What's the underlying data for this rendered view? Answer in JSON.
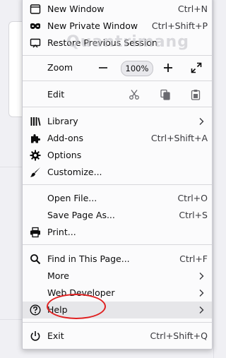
{
  "background": {
    "accent": "#0a84ff"
  },
  "watermark": {
    "text": "Quantrimang"
  },
  "menu": {
    "items": {
      "new_window": {
        "label": "New Window",
        "shortcut": "Ctrl+N",
        "icon": "new-window-icon"
      },
      "new_private_window": {
        "label": "New Private Window",
        "shortcut": "Ctrl+Shift+P",
        "icon": "mask-icon"
      },
      "restore_session": {
        "label": "Restore Previous Session",
        "icon": "restore-icon"
      },
      "zoom": {
        "label": "Zoom",
        "value": "100%",
        "icon_minus": "minus-icon",
        "icon_plus": "plus-icon",
        "icon_fullscreen": "fullscreen-icon"
      },
      "edit": {
        "label": "Edit",
        "icon_cut": "cut-icon",
        "icon_copy": "copy-icon",
        "icon_paste": "paste-icon"
      },
      "library": {
        "label": "Library",
        "icon": "library-icon",
        "has_submenu": true
      },
      "addons": {
        "label": "Add-ons",
        "shortcut": "Ctrl+Shift+A",
        "icon": "puzzle-icon"
      },
      "options": {
        "label": "Options",
        "icon": "gear-icon"
      },
      "customize": {
        "label": "Customize...",
        "icon": "brush-icon"
      },
      "open_file": {
        "label": "Open File...",
        "shortcut": "Ctrl+O"
      },
      "save_page": {
        "label": "Save Page As...",
        "shortcut": "Ctrl+S"
      },
      "print": {
        "label": "Print...",
        "icon": "printer-icon"
      },
      "find": {
        "label": "Find in This Page...",
        "shortcut": "Ctrl+F",
        "icon": "search-icon"
      },
      "more": {
        "label": "More",
        "has_submenu": true
      },
      "web_developer": {
        "label": "Web Developer",
        "has_submenu": true
      },
      "help": {
        "label": "Help",
        "icon": "help-icon",
        "has_submenu": true,
        "highlighted": true
      },
      "exit": {
        "label": "Exit",
        "shortcut": "Ctrl+Shift+Q",
        "icon": "power-icon"
      }
    }
  },
  "annotation": {
    "color": "#e02020",
    "target": "help"
  }
}
